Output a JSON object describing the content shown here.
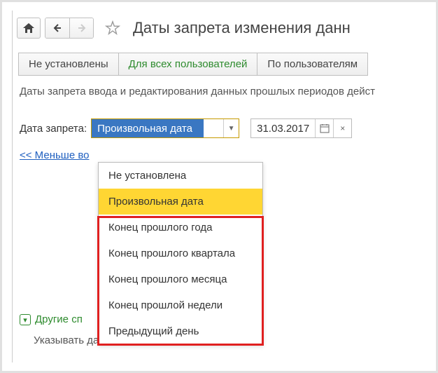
{
  "header": {
    "title": "Даты запрета изменения данн"
  },
  "tabs": {
    "items": [
      {
        "label": "Не установлены"
      },
      {
        "label": "Для всех пользователей"
      },
      {
        "label": "По пользователям"
      }
    ]
  },
  "description": "Даты запрета ввода и редактирования данных прошлых периодов дейст",
  "form": {
    "label": "Дата запрета:",
    "select_value": "Произвольная дата",
    "date_value": "31.03.2017"
  },
  "link_less": "<< Меньше во",
  "dropdown": {
    "options": [
      "Не установлена",
      "Произвольная дата",
      "Конец прошлого года",
      "Конец прошлого квартала",
      "Конец прошлого месяца",
      "Конец прошлой недели",
      "Предыдущий день"
    ]
  },
  "other": {
    "heading": "Другие сп",
    "sub": "Указывать да"
  }
}
